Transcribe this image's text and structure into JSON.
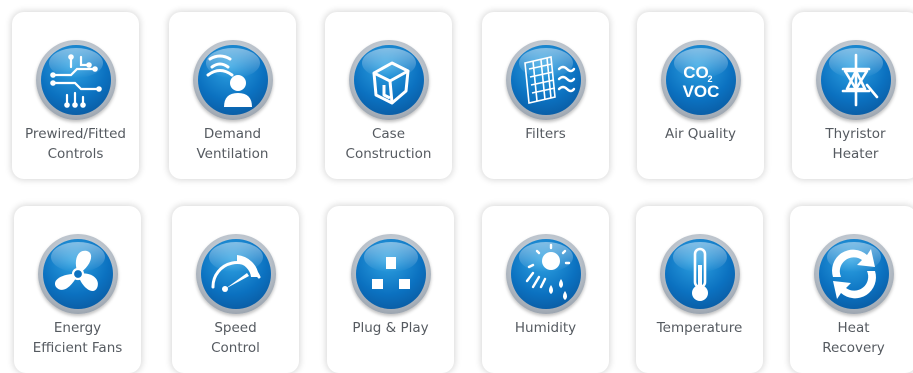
{
  "colors": {
    "icon_blue": "#0b71c0",
    "icon_ring": "#b8c0c9",
    "label_text": "#555a60",
    "tile_bg": "#ffffff"
  },
  "features": {
    "row1": [
      {
        "label": "Prewired/Fitted\nControls",
        "icon": "circuit-icon"
      },
      {
        "label": "Demand\nVentilation",
        "icon": "person-signal-icon"
      },
      {
        "label": "Case\nConstruction",
        "icon": "cube-icon"
      },
      {
        "label": "Filters",
        "icon": "filter-icon"
      },
      {
        "label": "Air Quality",
        "icon": "co2-voc-icon"
      },
      {
        "label": "Thyristor\nHeater",
        "icon": "thyristor-icon"
      }
    ],
    "row2": [
      {
        "label": "Energy\nEfficient Fans",
        "icon": "fan-icon"
      },
      {
        "label": "Speed\nControl",
        "icon": "gauge-icon"
      },
      {
        "label": "Plug & Play",
        "icon": "plug-icon"
      },
      {
        "label": "Humidity",
        "icon": "sun-rain-icon"
      },
      {
        "label": "Temperature",
        "icon": "thermometer-icon"
      },
      {
        "label": "Heat\nRecovery",
        "icon": "recycle-arrows-icon"
      }
    ]
  },
  "icon_text": {
    "co2_line1": "CO",
    "co2_sub": "2",
    "voc_line": "VOC"
  }
}
